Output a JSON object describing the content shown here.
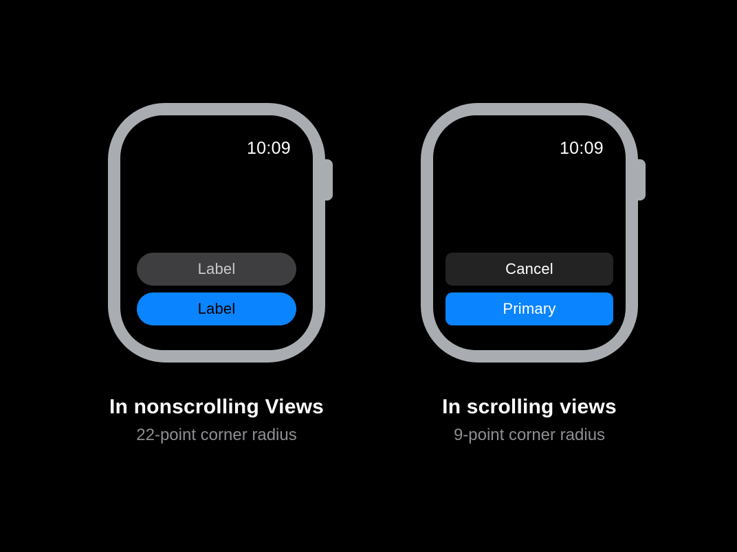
{
  "left": {
    "time": "10:09",
    "button_top": "Label",
    "button_bottom": "Label",
    "caption_title": "In nonscrolling Views",
    "caption_sub": "22-point corner radius"
  },
  "right": {
    "time": "10:09",
    "button_top": "Cancel",
    "button_bottom": "Primary",
    "caption_title": "In scrolling views",
    "caption_sub": "9-point corner radius"
  }
}
